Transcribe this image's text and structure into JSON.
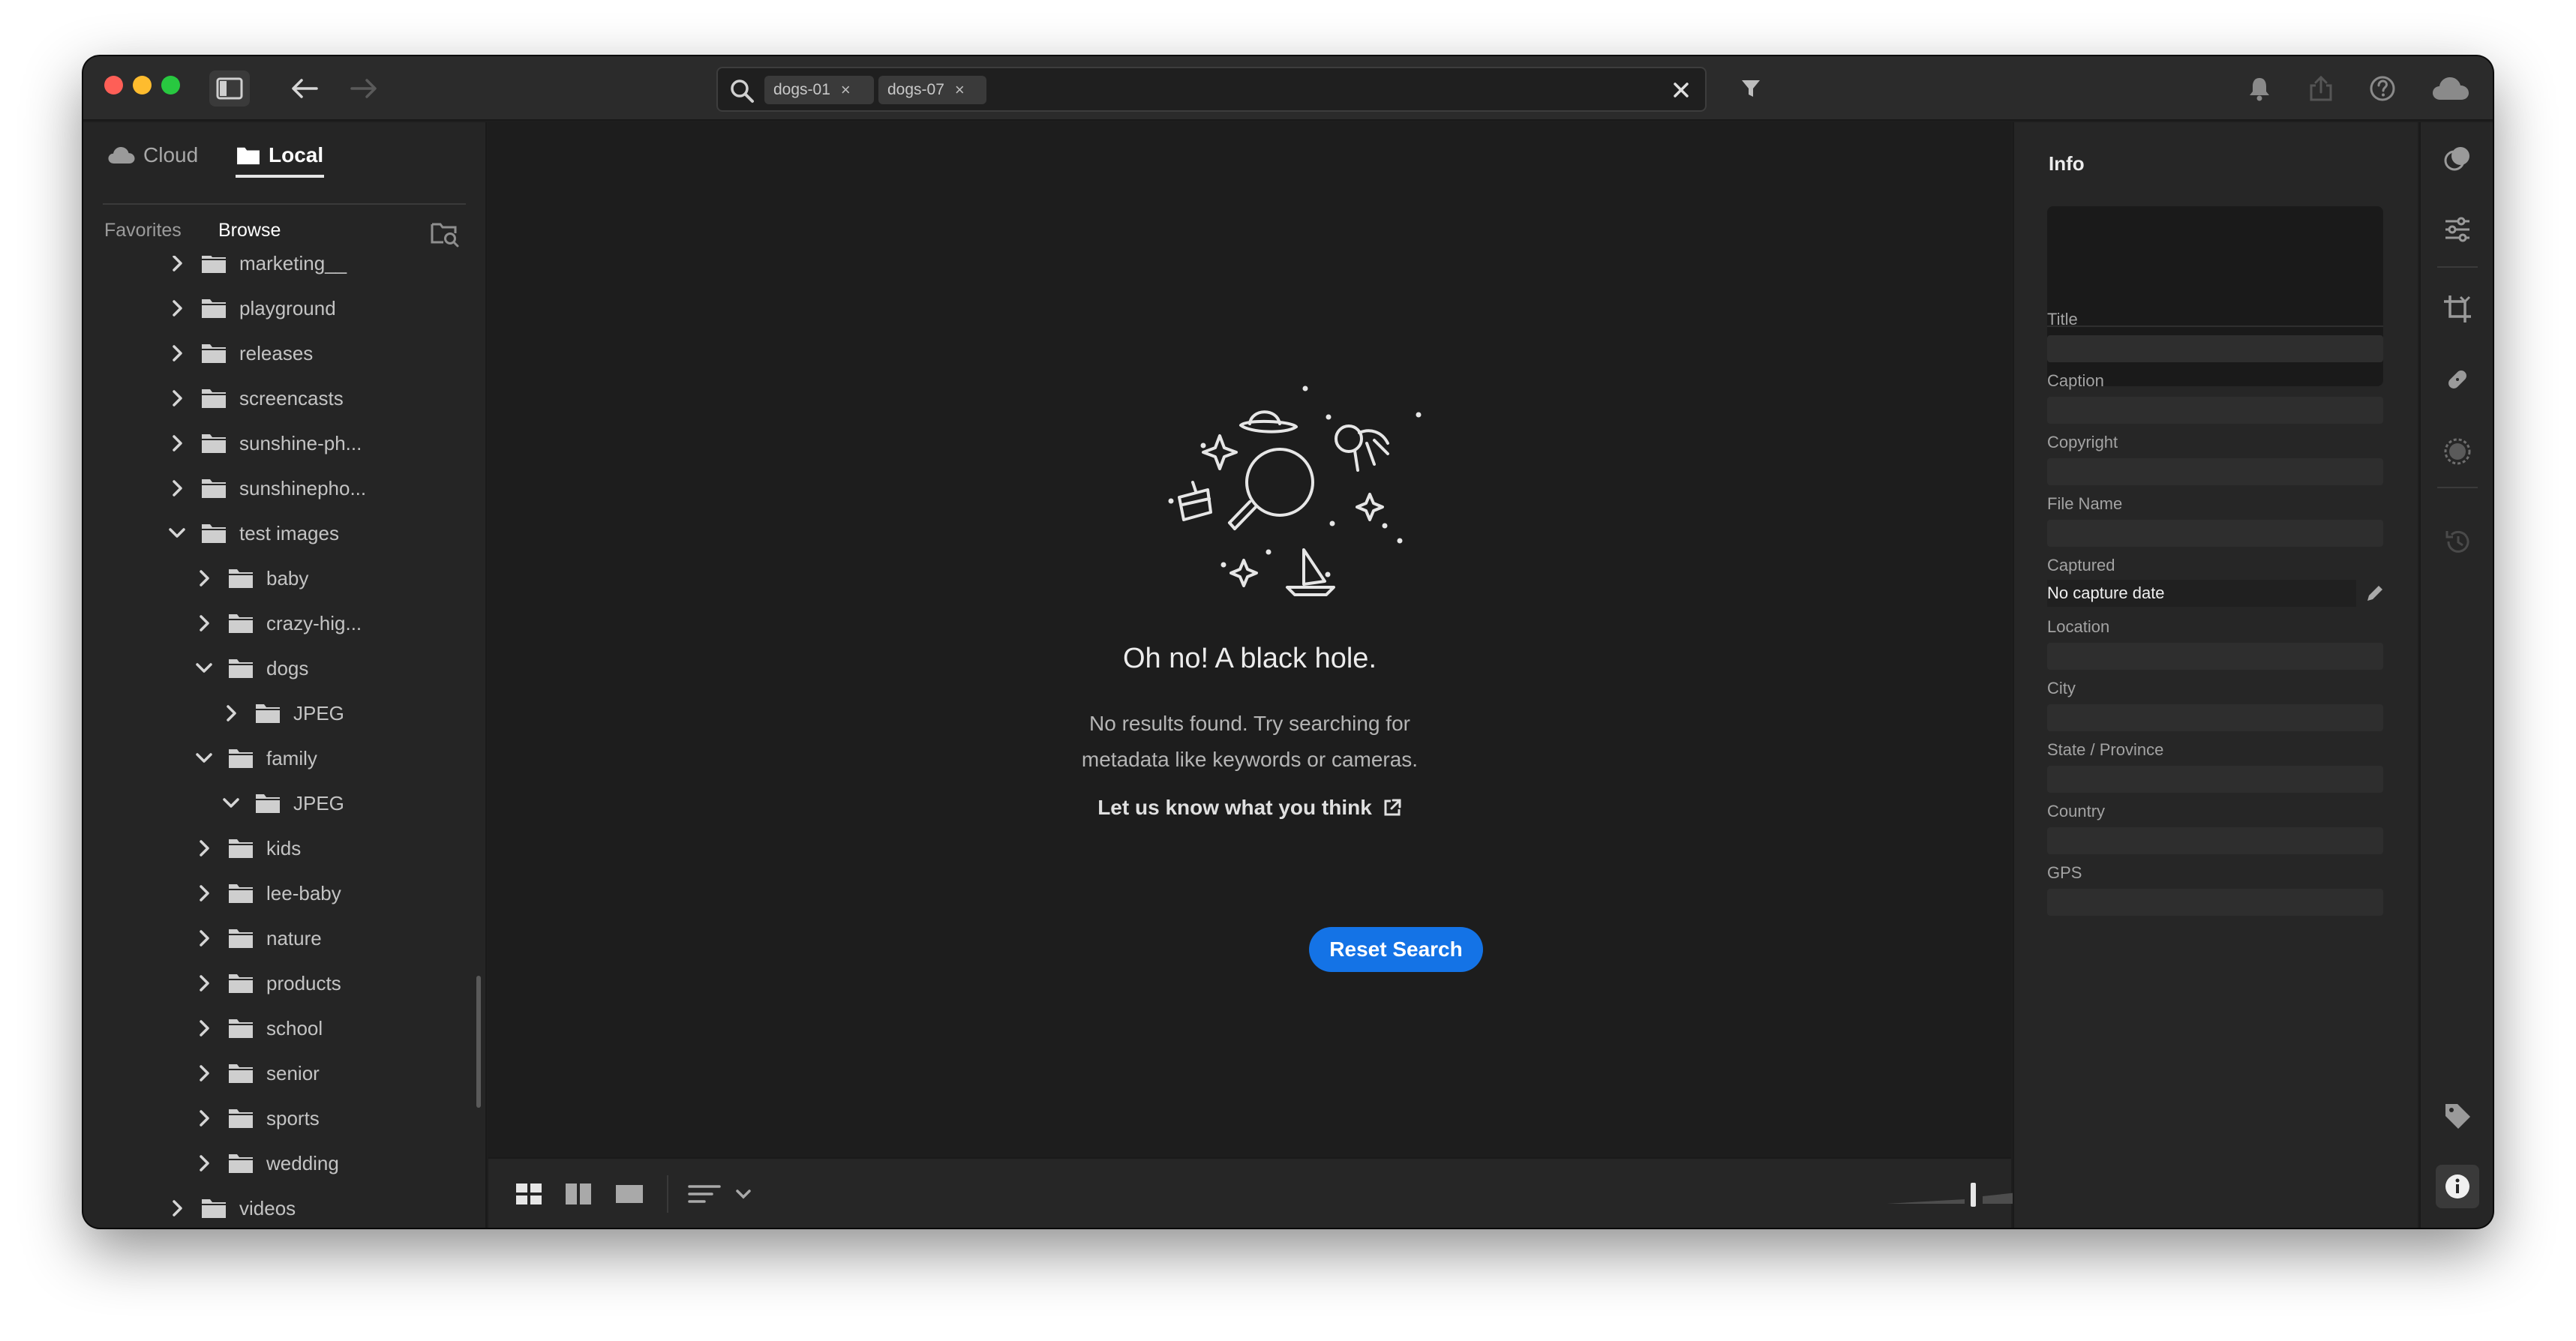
{
  "search": {
    "chips": [
      {
        "label": "dogs-01"
      },
      {
        "label": "dogs-07"
      }
    ]
  },
  "left_panel": {
    "source_tabs": {
      "cloud": "Cloud",
      "local": "Local"
    },
    "sub_tabs": {
      "favorites": "Favorites",
      "browse": "Browse"
    },
    "tree": [
      {
        "label": "marketing__",
        "level": 1,
        "state": "collapsed"
      },
      {
        "label": "playground",
        "level": 1,
        "state": "collapsed"
      },
      {
        "label": "releases",
        "level": 1,
        "state": "collapsed"
      },
      {
        "label": "screencasts",
        "level": 1,
        "state": "collapsed"
      },
      {
        "label": "sunshine-ph...",
        "level": 1,
        "state": "collapsed"
      },
      {
        "label": "sunshinepho...",
        "level": 1,
        "state": "collapsed"
      },
      {
        "label": "test images",
        "level": 1,
        "state": "expanded"
      },
      {
        "label": "baby",
        "level": 2,
        "state": "collapsed"
      },
      {
        "label": "crazy-hig...",
        "level": 2,
        "state": "collapsed"
      },
      {
        "label": "dogs",
        "level": 2,
        "state": "expanded"
      },
      {
        "label": "JPEG",
        "level": 3,
        "state": "collapsed"
      },
      {
        "label": "family",
        "level": 2,
        "state": "expanded"
      },
      {
        "label": "JPEG",
        "level": 3,
        "state": "expanded"
      },
      {
        "label": "kids",
        "level": 2,
        "state": "collapsed"
      },
      {
        "label": "lee-baby",
        "level": 2,
        "state": "collapsed"
      },
      {
        "label": "nature",
        "level": 2,
        "state": "collapsed"
      },
      {
        "label": "products",
        "level": 2,
        "state": "collapsed"
      },
      {
        "label": "school",
        "level": 2,
        "state": "collapsed"
      },
      {
        "label": "senior",
        "level": 2,
        "state": "collapsed"
      },
      {
        "label": "sports",
        "level": 2,
        "state": "collapsed"
      },
      {
        "label": "wedding",
        "level": 2,
        "state": "collapsed"
      },
      {
        "label": "videos",
        "level": 1,
        "state": "collapsed"
      }
    ]
  },
  "empty_state": {
    "title": "Oh no! A black hole.",
    "message": "No results found. Try searching for metadata like keywords or cameras.",
    "feedback_link": "Let us know what you think",
    "reset_button": "Reset Search"
  },
  "info_panel": {
    "title": "Info",
    "fields": [
      {
        "label": "Title",
        "value": ""
      },
      {
        "label": "Caption",
        "value": ""
      },
      {
        "label": "Copyright",
        "value": ""
      },
      {
        "label": "File Name",
        "value": ""
      },
      {
        "label": "Captured",
        "value": "No capture date",
        "editable": true
      },
      {
        "label": "Location",
        "value": ""
      },
      {
        "label": "City",
        "value": ""
      },
      {
        "label": "State / Province",
        "value": ""
      },
      {
        "label": "Country",
        "value": ""
      },
      {
        "label": "GPS",
        "value": ""
      }
    ]
  },
  "colors": {
    "accent": "#1473e6",
    "traffic_red": "#fe5f57",
    "traffic_yellow": "#febc2e",
    "traffic_green": "#28c840"
  }
}
